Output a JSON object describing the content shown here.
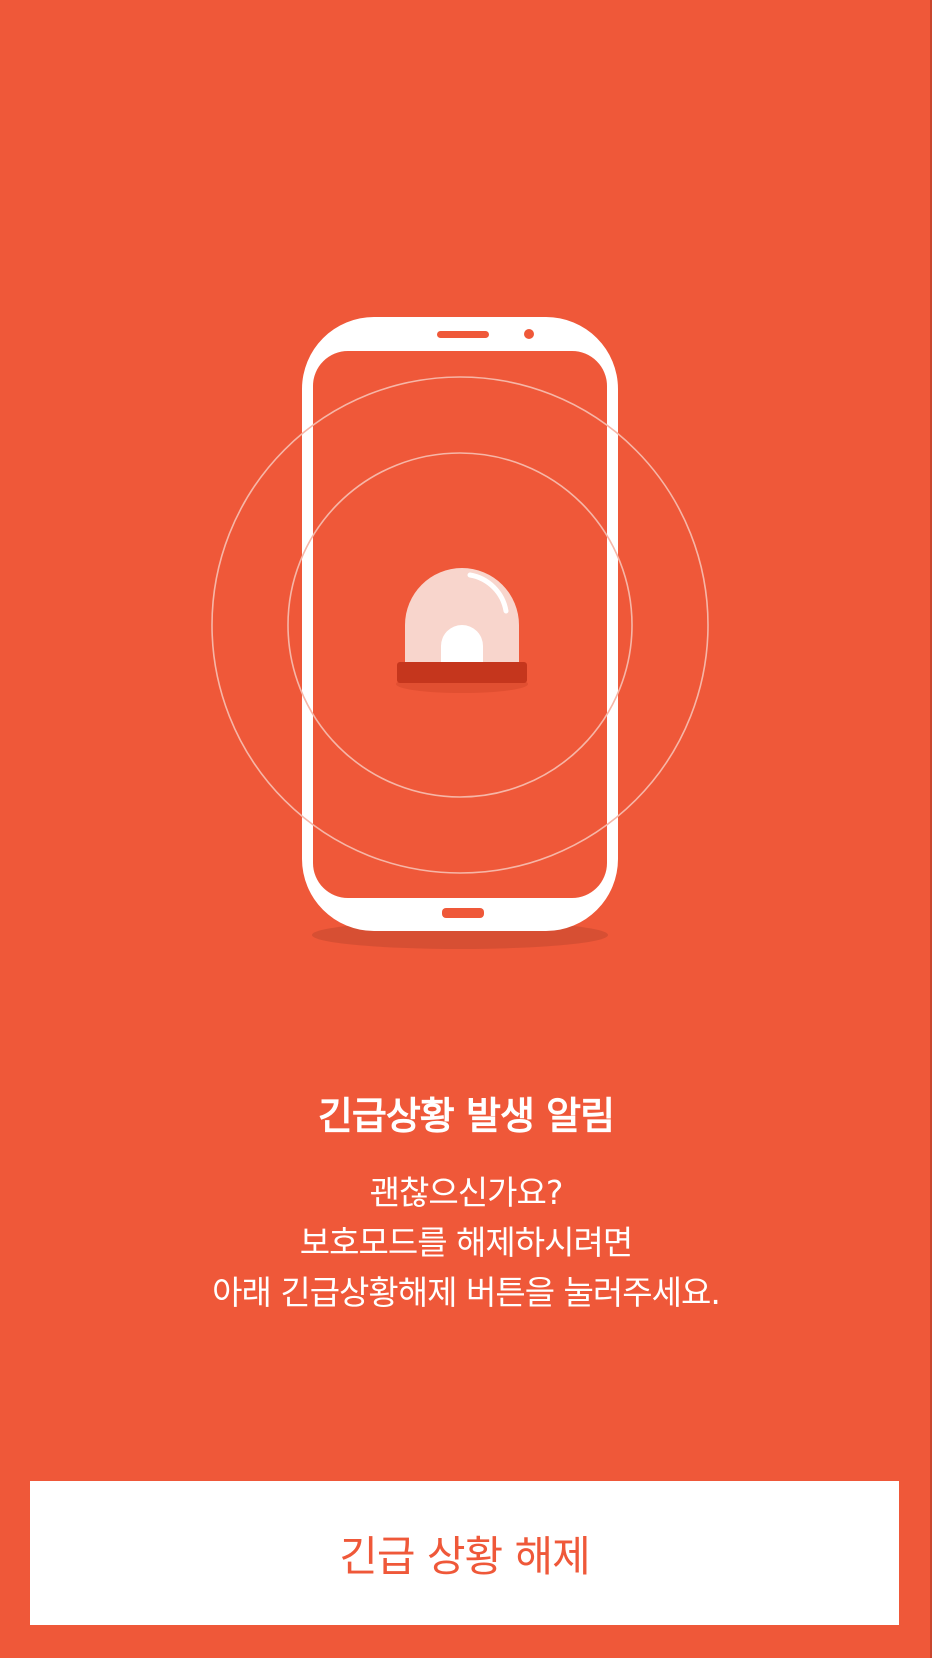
{
  "colors": {
    "background": "#EF5839",
    "foreground": "#FFFFFF",
    "siren_base": "#C5361D",
    "siren_dome": "#F8D5CC",
    "button_text": "#EF5839"
  },
  "illustration": {
    "icons": [
      "smartphone-icon",
      "siren-icon",
      "signal-waves-icon"
    ]
  },
  "alert": {
    "title": "긴급상황 발생 알림",
    "message_lines": [
      "괜찮으신가요?",
      "보호모드를 해제하시려면",
      "아래 긴급상황해제 버튼을 눌러주세요."
    ]
  },
  "actions": {
    "release_button_label": "긴급 상황 해제"
  }
}
